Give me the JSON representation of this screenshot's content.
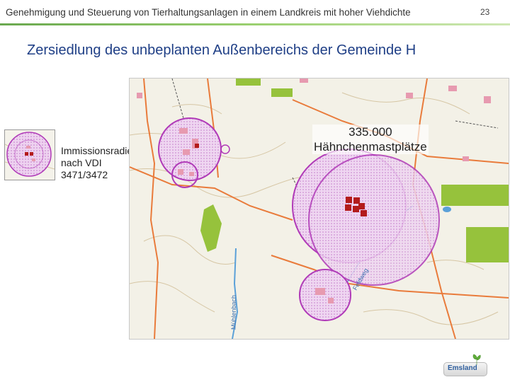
{
  "header": {
    "title": "Genehmigung und Steuerung von Tierhaltungsanlagen in einem Landkreis mit hoher Viehdichte",
    "page_number": "23"
  },
  "slide": {
    "title": "Zersiedlung des unbeplanten Außenbereichs der Gemeinde H"
  },
  "legend": {
    "lines": [
      "Immissionsradien",
      "nach VDI",
      "3471/3472"
    ]
  },
  "annotation": {
    "lines": [
      "335.000",
      "Hähnchenmastplätze"
    ]
  },
  "map": {
    "road_labels": [
      "Mühlenbach",
      "Feldweg"
    ],
    "colors": {
      "background": "#f3f1e7",
      "radius_circle": "#b03ab8",
      "radius_fill": "#e7c3ea",
      "barn": "#b31b1b",
      "road": "#e97b3b",
      "river": "#5aa0d8",
      "green_area": "#96c23c",
      "contour": "#d6c6a4"
    }
  },
  "footer": {
    "logo_text": "Emsland"
  }
}
